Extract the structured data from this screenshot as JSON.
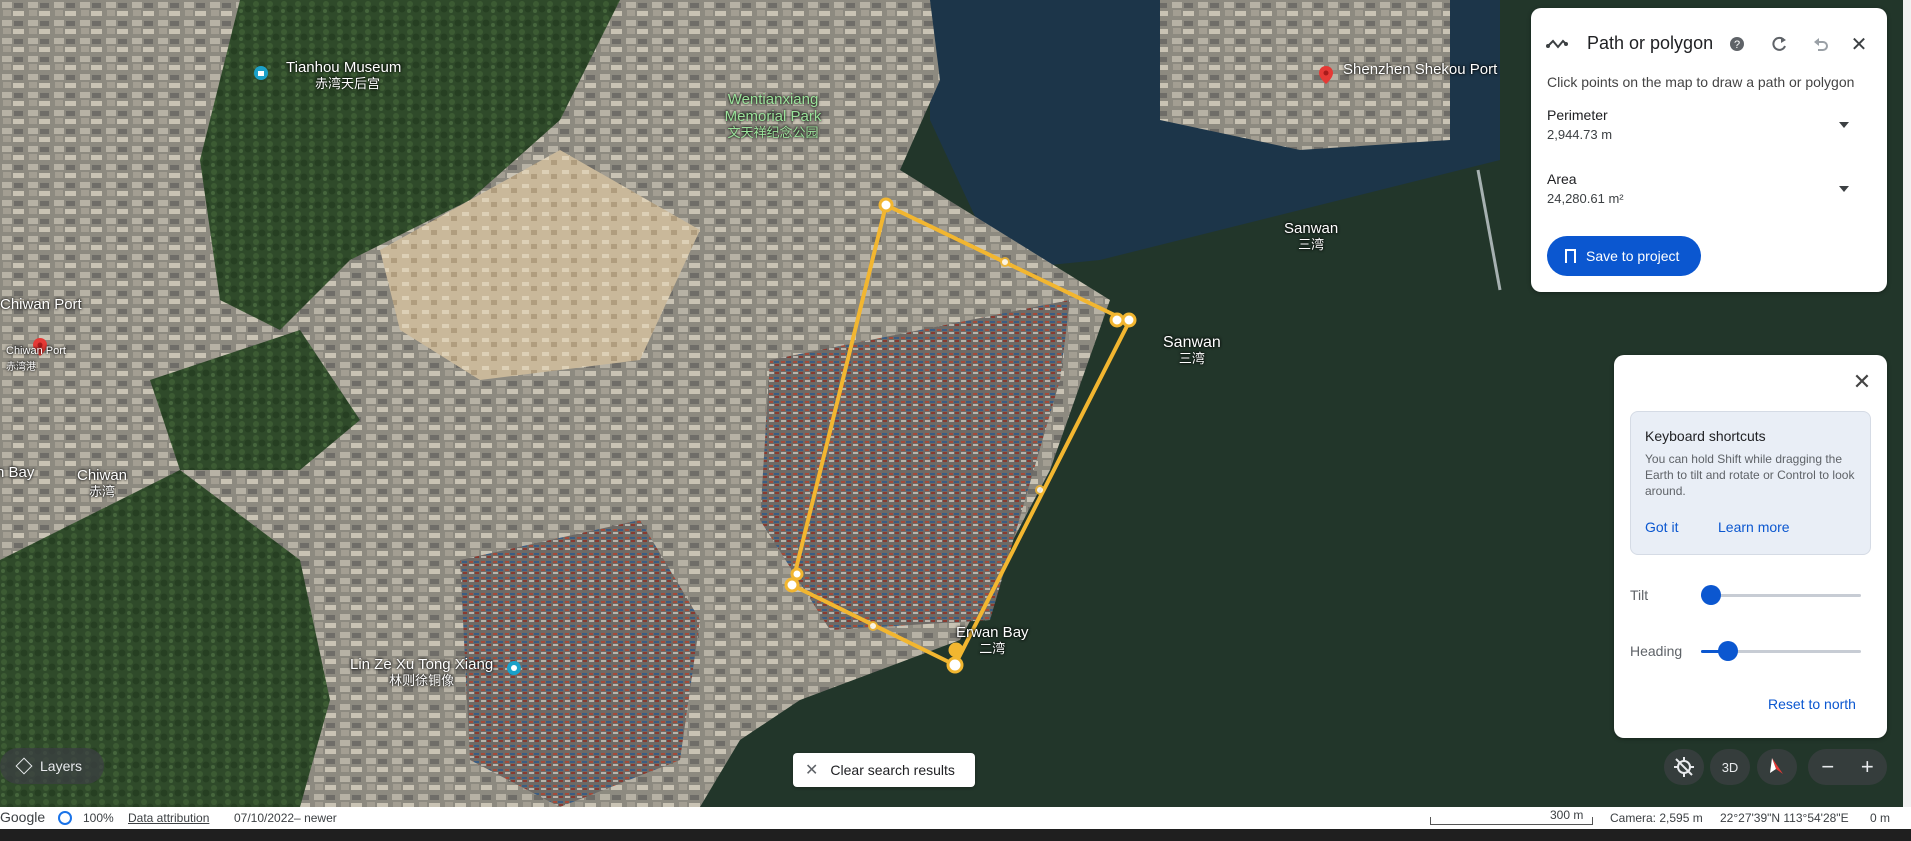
{
  "map": {
    "labels": {
      "tianhou_museum": {
        "name": "Tianhou Museum",
        "sub": "赤湾天后宫"
      },
      "wentianxiang": {
        "name": "Wentianxiang Memorial Park",
        "sub": "文天祥纪念公园"
      },
      "shekou_port": {
        "name": "Shenzhen Shekou Port"
      },
      "sanwan_1": {
        "name": "Sanwan",
        "sub": "三湾"
      },
      "sanwan_2": {
        "name": "Sanwan",
        "sub": "三湾"
      },
      "chiwan_port": {
        "name": "Chiwan Port"
      },
      "chiwan_port_small": {
        "name": "Chiwan Port",
        "sub": "赤湾港"
      },
      "chiwan": {
        "name": "Chiwan",
        "sub": "赤湾"
      },
      "bay": {
        "name": "n Bay"
      },
      "erwan_bay": {
        "name": "Erwan Bay",
        "sub": "二湾"
      },
      "lin_ze_xu": {
        "name": "Lin Ze Xu Tong Xiang",
        "sub": "林则徐铜像"
      }
    }
  },
  "path_panel": {
    "title": "Path or polygon",
    "icons": [
      "path-icon",
      "help-icon",
      "refresh-icon",
      "undo-icon",
      "close-icon"
    ],
    "description": "Click points on the map to draw a path or polygon",
    "perimeter": {
      "label": "Perimeter",
      "value": "2,944.73 m"
    },
    "area": {
      "label": "Area",
      "value": "24,280.61 m²"
    },
    "save_label": "Save to project"
  },
  "camera_panel": {
    "shortcuts_title": "Keyboard shortcuts",
    "shortcuts_text": "You can hold Shift while dragging the Earth to tilt and rotate or Control to look around.",
    "got_it": "Got it",
    "learn_more": "Learn more",
    "tilt_label": "Tilt",
    "tilt_value": 0.0,
    "heading_label": "Heading",
    "heading_value": 0.12,
    "reset_label": "Reset to north"
  },
  "controls": {
    "layers_label": "Layers",
    "clear_label": "Clear search results",
    "three_d_label": "3D",
    "zoom_out": "−",
    "zoom_in": "+"
  },
  "status_bar": {
    "brand": "Google",
    "zoom": "100%",
    "attribution": "Data attribution",
    "date": "07/10/2022– newer",
    "scale": "300 m",
    "camera": "Camera: 2,595 m",
    "coords": "22°27'39\"N 113°54'28\"E",
    "elevation": "0 m"
  },
  "colors": {
    "accent": "#0b57d0",
    "polygon": "#f2b630",
    "water": "#22362a"
  }
}
